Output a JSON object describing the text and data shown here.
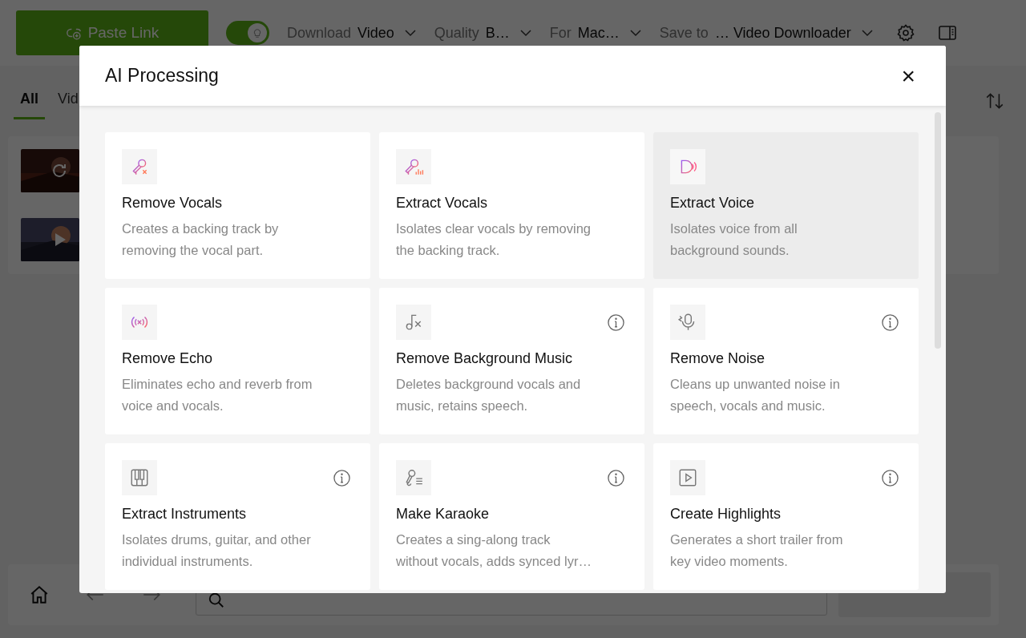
{
  "toolbar": {
    "paste_button": "Paste Link",
    "smart_mode": {
      "on": true
    },
    "dropdowns": [
      {
        "label": "Download",
        "value": "Video"
      },
      {
        "label": "Quality",
        "value": "B…"
      },
      {
        "label": "For",
        "value": "Mac…"
      },
      {
        "label": "Save to",
        "value": "… Video Downloader"
      }
    ]
  },
  "tabs": [
    {
      "label": "All",
      "selected": true
    },
    {
      "label": "Vid",
      "selected": false
    }
  ],
  "downloads": [
    {
      "kind": "loading"
    },
    {
      "kind": "paused"
    }
  ],
  "dialog": {
    "title": "AI Processing",
    "close": "×",
    "cards": [
      {
        "title": "Remove Vocals",
        "description": [
          "Creates a backing track by",
          "removing the vocal part."
        ],
        "info": false,
        "highlighted": false
      },
      {
        "title": "Extract Vocals",
        "description": [
          "Isolates clear vocals by removing",
          "the backing track."
        ],
        "info": false,
        "highlighted": false
      },
      {
        "title": "Extract Voice",
        "description": [
          "Isolates voice from all",
          "background sounds."
        ],
        "info": false,
        "highlighted": true
      },
      {
        "title": "Remove Echo",
        "description": [
          "Eliminates echo and reverb from",
          "voice and vocals."
        ],
        "info": false,
        "highlighted": false
      },
      {
        "title": "Remove Background Music",
        "description": [
          "Deletes background vocals and",
          "music, retains speech."
        ],
        "info": true,
        "highlighted": false
      },
      {
        "title": "Remove Noise",
        "description": [
          "Cleans up unwanted noise in",
          "speech, vocals and music."
        ],
        "info": true,
        "highlighted": false
      },
      {
        "title": "Extract Instruments",
        "description": [
          "Isolates drums, guitar, and other",
          "individual instruments."
        ],
        "info": true,
        "highlighted": false
      },
      {
        "title": "Make Karaoke",
        "description": [
          "Creates a sing-along track",
          "without vocals, adds synced lyr…"
        ],
        "info": true,
        "highlighted": false
      },
      {
        "title": "Create Highlights",
        "description": [
          "Generates a short trailer from",
          "key video moments."
        ],
        "info": true,
        "highlighted": false
      }
    ]
  }
}
